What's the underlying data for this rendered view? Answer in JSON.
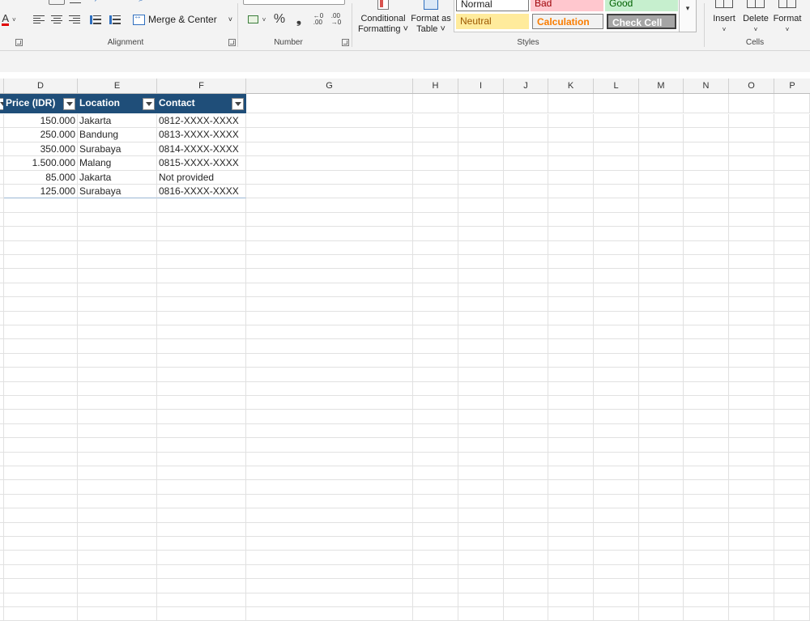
{
  "ribbon": {
    "groups": {
      "alignment": "Alignment",
      "number": "Number",
      "styles": "Styles",
      "cells": "Cells"
    },
    "merge_center": "Merge & Center",
    "percent_symbol": "%",
    "comma_symbol": "❟",
    "conditional_formatting": [
      "Conditional",
      "Formatting ˅"
    ],
    "format_as_table": [
      "Format as",
      "Table ˅"
    ],
    "cell_styles": {
      "normal": "Normal",
      "bad": "Bad",
      "good": "Good",
      "neutral": "Neutral",
      "calculation": "Calculation",
      "check_cell": "Check Cell"
    },
    "cells_buttons": {
      "insert": "Insert",
      "delete": "Delete",
      "format": "Format"
    },
    "colors": {
      "neutral_bg": "#ffeb9c",
      "neutral_fg": "#9c5700",
      "bad_bg": "#ffc7ce",
      "good_bg": "#c6efce",
      "calc_fg": "#fa7d00",
      "check_bg": "#a5a5a5"
    }
  },
  "columns": [
    "D",
    "E",
    "F",
    "G",
    "H",
    "I",
    "J",
    "K",
    "L",
    "M",
    "N",
    "O",
    "P"
  ],
  "table": {
    "headers": [
      "Price (IDR)",
      "Location",
      "Contact"
    ],
    "header_color": "#1f4e79",
    "rows": [
      [
        "150.000",
        "Jakarta",
        "0812-XXXX-XXXX"
      ],
      [
        "250.000",
        "Bandung",
        "0813-XXXX-XXXX"
      ],
      [
        "350.000",
        "Surabaya",
        "0814-XXXX-XXXX"
      ],
      [
        "1.500.000",
        "Malang",
        "0815-XXXX-XXXX"
      ],
      [
        "85.000",
        "Jakarta",
        "Not provided"
      ],
      [
        "125.000",
        "Surabaya",
        "0816-XXXX-XXXX"
      ]
    ]
  }
}
